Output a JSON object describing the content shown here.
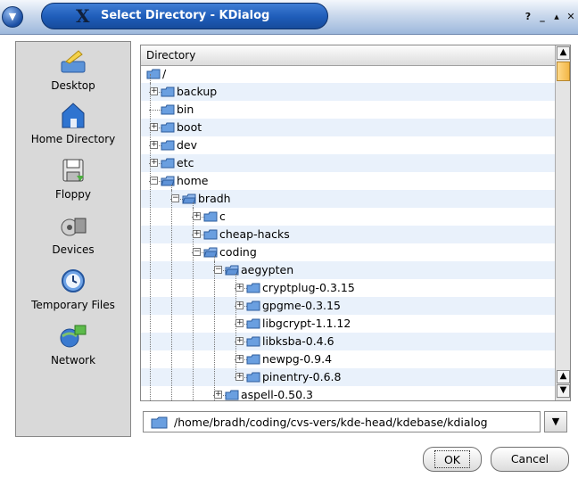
{
  "window": {
    "title": "Select Directory - KDialog",
    "buttons": [
      "?",
      "_",
      "▴",
      "✕"
    ]
  },
  "sidebar": {
    "items": [
      {
        "label": "Desktop",
        "icon": "desktop-icon"
      },
      {
        "label": "Home Directory",
        "icon": "home-folder-icon"
      },
      {
        "label": "Floppy",
        "icon": "floppy-icon"
      },
      {
        "label": "Devices",
        "icon": "devices-icon"
      },
      {
        "label": "Temporary Files",
        "icon": "clock-icon"
      },
      {
        "label": "Network",
        "icon": "network-icon"
      }
    ]
  },
  "tree": {
    "header": "Directory",
    "root": "/",
    "rows": [
      {
        "label": "backup",
        "depth": 1,
        "expandable": true,
        "expanded": false
      },
      {
        "label": "bin",
        "depth": 1,
        "expandable": false,
        "expanded": false
      },
      {
        "label": "boot",
        "depth": 1,
        "expandable": true,
        "expanded": false
      },
      {
        "label": "dev",
        "depth": 1,
        "expandable": true,
        "expanded": false
      },
      {
        "label": "etc",
        "depth": 1,
        "expandable": true,
        "expanded": false
      },
      {
        "label": "home",
        "depth": 1,
        "expandable": true,
        "expanded": true
      },
      {
        "label": "bradh",
        "depth": 2,
        "expandable": true,
        "expanded": true
      },
      {
        "label": "c",
        "depth": 3,
        "expandable": true,
        "expanded": false
      },
      {
        "label": "cheap-hacks",
        "depth": 3,
        "expandable": true,
        "expanded": false
      },
      {
        "label": "coding",
        "depth": 3,
        "expandable": true,
        "expanded": true
      },
      {
        "label": "aegypten",
        "depth": 4,
        "expandable": true,
        "expanded": true
      },
      {
        "label": "cryptplug-0.3.15",
        "depth": 5,
        "expandable": true,
        "expanded": false
      },
      {
        "label": "gpgme-0.3.15",
        "depth": 5,
        "expandable": true,
        "expanded": false
      },
      {
        "label": "libgcrypt-1.1.12",
        "depth": 5,
        "expandable": true,
        "expanded": false
      },
      {
        "label": "libksba-0.4.6",
        "depth": 5,
        "expandable": true,
        "expanded": false
      },
      {
        "label": "newpg-0.9.4",
        "depth": 5,
        "expandable": true,
        "expanded": false
      },
      {
        "label": "pinentry-0.6.8",
        "depth": 5,
        "expandable": true,
        "expanded": false
      },
      {
        "label": "aspell-0.50.3",
        "depth": 4,
        "expandable": true,
        "expanded": false
      }
    ]
  },
  "path": {
    "value": "/home/bradh/coding/cvs-vers/kde-head/kdebase/kdialog"
  },
  "buttons": {
    "ok": "OK",
    "cancel": "Cancel"
  },
  "colors": {
    "title_bar": "#1e5cb8",
    "row_alt": "#e9f1fb",
    "folder": "#6a9fe0"
  }
}
